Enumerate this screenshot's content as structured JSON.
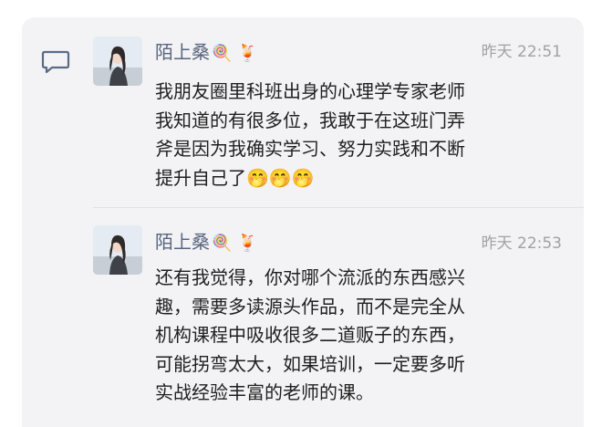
{
  "comments": [
    {
      "author": "陌上桑",
      "name_decorations": "🍭 🍹",
      "time": "昨天 22:51",
      "lines": [
        "我朋友圈里科班出身的心理学专家老师",
        "我知道的有很多位，我敢于在这班门弄",
        "斧是因为我确实学习、努力实践和不断",
        "提升自己了🤭🤭🤭"
      ]
    },
    {
      "author": "陌上桑",
      "name_decorations": "🍭 🍹",
      "time": "昨天 22:53",
      "lines": [
        "还有我觉得，你对哪个流派的东西感兴",
        "趣，需要多读源头作品，而不是完全从",
        "机构课程中吸收很多二道贩子的东西，",
        "可能拐弯太大，如果培训，一定要多听",
        "实战经验丰富的老师的课。"
      ]
    }
  ],
  "icons": {
    "comment": "comment-bubble-icon",
    "avatar": "user-avatar"
  },
  "colors": {
    "panel_bg": "#f3f3f5",
    "name": "#59647e",
    "time": "#a0a0a6",
    "text": "#1f1f1f"
  }
}
